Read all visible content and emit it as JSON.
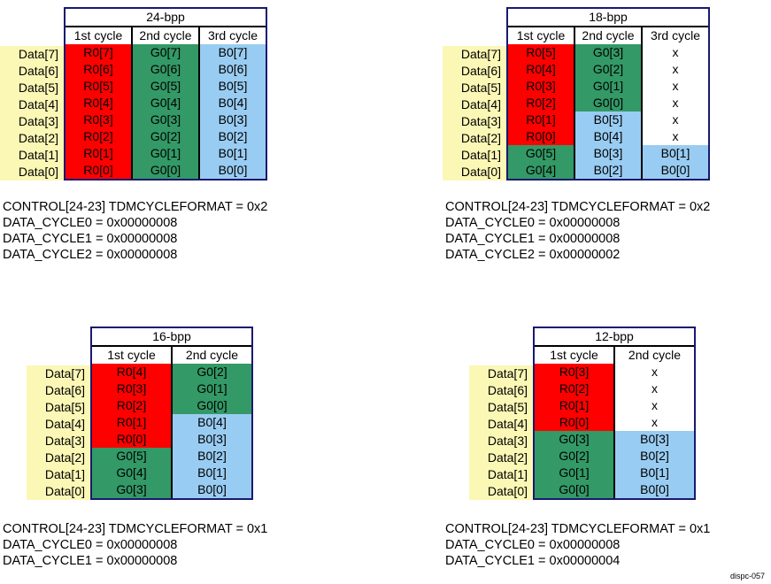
{
  "figure_id": "dispc-057",
  "colors": {
    "red": "#FF0000",
    "green": "#339966",
    "blue": "#99CCF2",
    "yellow": "#FBF7B5",
    "white": "#FFFFFF",
    "border_outer": "#191970",
    "border_inner": "#000000"
  },
  "row_labels": [
    "Data[7]",
    "Data[6]",
    "Data[5]",
    "Data[4]",
    "Data[3]",
    "Data[2]",
    "Data[1]",
    "Data[0]"
  ],
  "panels": [
    {
      "id": "24bpp",
      "title": "24-bpp",
      "cycle_headers": [
        "1st cycle",
        "2nd cycle",
        "3rd cycle"
      ],
      "columns": [
        {
          "header": "1st cycle",
          "cells": [
            {
              "text": "R0[7]",
              "color": "red"
            },
            {
              "text": "R0[6]",
              "color": "red"
            },
            {
              "text": "R0[5]",
              "color": "red"
            },
            {
              "text": "R0[4]",
              "color": "red"
            },
            {
              "text": "R0[3]",
              "color": "red"
            },
            {
              "text": "R0[2]",
              "color": "red"
            },
            {
              "text": "R0[1]",
              "color": "red"
            },
            {
              "text": "R0[0]",
              "color": "red"
            }
          ]
        },
        {
          "header": "2nd cycle",
          "cells": [
            {
              "text": "G0[7]",
              "color": "green"
            },
            {
              "text": "G0[6]",
              "color": "green"
            },
            {
              "text": "G0[5]",
              "color": "green"
            },
            {
              "text": "G0[4]",
              "color": "green"
            },
            {
              "text": "G0[3]",
              "color": "green"
            },
            {
              "text": "G0[2]",
              "color": "green"
            },
            {
              "text": "G0[1]",
              "color": "green"
            },
            {
              "text": "G0[0]",
              "color": "green"
            }
          ]
        },
        {
          "header": "3rd cycle",
          "cells": [
            {
              "text": "B0[7]",
              "color": "blue"
            },
            {
              "text": "B0[6]",
              "color": "blue"
            },
            {
              "text": "B0[5]",
              "color": "blue"
            },
            {
              "text": "B0[4]",
              "color": "blue"
            },
            {
              "text": "B0[3]",
              "color": "blue"
            },
            {
              "text": "B0[2]",
              "color": "blue"
            },
            {
              "text": "B0[1]",
              "color": "blue"
            },
            {
              "text": "B0[0]",
              "color": "blue"
            }
          ]
        }
      ],
      "caption": [
        "CONTROL[24-23] TDMCYCLEFORMAT = 0x2",
        "DATA_CYCLE0 = 0x00000008",
        "DATA_CYCLE1 = 0x00000008",
        "DATA_CYCLE2 = 0x00000008"
      ]
    },
    {
      "id": "18bpp",
      "title": "18-bpp",
      "cycle_headers": [
        "1st cycle",
        "2nd cycle",
        "3rd cycle"
      ],
      "columns": [
        {
          "header": "1st cycle",
          "cells": [
            {
              "text": "R0[5]",
              "color": "red"
            },
            {
              "text": "R0[4]",
              "color": "red"
            },
            {
              "text": "R0[3]",
              "color": "red"
            },
            {
              "text": "R0[2]",
              "color": "red"
            },
            {
              "text": "R0[1]",
              "color": "red"
            },
            {
              "text": "R0[0]",
              "color": "red"
            },
            {
              "text": "G0[5]",
              "color": "green"
            },
            {
              "text": "G0[4]",
              "color": "green"
            }
          ]
        },
        {
          "header": "2nd cycle",
          "cells": [
            {
              "text": "G0[3]",
              "color": "green"
            },
            {
              "text": "G0[2]",
              "color": "green"
            },
            {
              "text": "G0[1]",
              "color": "green"
            },
            {
              "text": "G0[0]",
              "color": "green"
            },
            {
              "text": "B0[5]",
              "color": "blue"
            },
            {
              "text": "B0[4]",
              "color": "blue"
            },
            {
              "text": "B0[3]",
              "color": "blue"
            },
            {
              "text": "B0[2]",
              "color": "blue"
            }
          ]
        },
        {
          "header": "3rd cycle",
          "cells": [
            {
              "text": "x",
              "color": "white"
            },
            {
              "text": "x",
              "color": "white"
            },
            {
              "text": "x",
              "color": "white"
            },
            {
              "text": "x",
              "color": "white"
            },
            {
              "text": "x",
              "color": "white"
            },
            {
              "text": "x",
              "color": "white"
            },
            {
              "text": "B0[1]",
              "color": "blue"
            },
            {
              "text": "B0[0]",
              "color": "blue"
            }
          ]
        }
      ],
      "caption": [
        "CONTROL[24-23] TDMCYCLEFORMAT = 0x2",
        "DATA_CYCLE0 = 0x00000008",
        "DATA_CYCLE1 = 0x00000008",
        "DATA_CYCLE2 = 0x00000002"
      ]
    },
    {
      "id": "16bpp",
      "title": "16-bpp",
      "cycle_headers": [
        "1st cycle",
        "2nd cycle"
      ],
      "columns": [
        {
          "header": "1st cycle",
          "cells": [
            {
              "text": "R0[4]",
              "color": "red"
            },
            {
              "text": "R0[3]",
              "color": "red"
            },
            {
              "text": "R0[2]",
              "color": "red"
            },
            {
              "text": "R0[1]",
              "color": "red"
            },
            {
              "text": "R0[0]",
              "color": "red"
            },
            {
              "text": "G0[5]",
              "color": "green"
            },
            {
              "text": "G0[4]",
              "color": "green"
            },
            {
              "text": "G0[3]",
              "color": "green"
            }
          ]
        },
        {
          "header": "2nd cycle",
          "cells": [
            {
              "text": "G0[2]",
              "color": "green"
            },
            {
              "text": "G0[1]",
              "color": "green"
            },
            {
              "text": "G0[0]",
              "color": "green"
            },
            {
              "text": "B0[4]",
              "color": "blue"
            },
            {
              "text": "B0[3]",
              "color": "blue"
            },
            {
              "text": "B0[2]",
              "color": "blue"
            },
            {
              "text": "B0[1]",
              "color": "blue"
            },
            {
              "text": "B0[0]",
              "color": "blue"
            }
          ]
        }
      ],
      "caption": [
        "CONTROL[24-23] TDMCYCLEFORMAT = 0x1",
        "DATA_CYCLE0 = 0x00000008",
        "DATA_CYCLE1 = 0x00000008"
      ]
    },
    {
      "id": "12bpp",
      "title": "12-bpp",
      "cycle_headers": [
        "1st cycle",
        "2nd cycle"
      ],
      "columns": [
        {
          "header": "1st cycle",
          "cells": [
            {
              "text": "R0[3]",
              "color": "red"
            },
            {
              "text": "R0[2]",
              "color": "red"
            },
            {
              "text": "R0[1]",
              "color": "red"
            },
            {
              "text": "R0[0]",
              "color": "red"
            },
            {
              "text": "G0[3]",
              "color": "green"
            },
            {
              "text": "G0[2]",
              "color": "green"
            },
            {
              "text": "G0[1]",
              "color": "green"
            },
            {
              "text": "G0[0]",
              "color": "green"
            }
          ]
        },
        {
          "header": "2nd cycle",
          "cells": [
            {
              "text": "x",
              "color": "white"
            },
            {
              "text": "x",
              "color": "white"
            },
            {
              "text": "x",
              "color": "white"
            },
            {
              "text": "x",
              "color": "white"
            },
            {
              "text": "B0[3]",
              "color": "blue"
            },
            {
              "text": "B0[2]",
              "color": "blue"
            },
            {
              "text": "B0[1]",
              "color": "blue"
            },
            {
              "text": "B0[0]",
              "color": "blue"
            }
          ]
        }
      ],
      "caption": [
        "CONTROL[24-23] TDMCYCLEFORMAT = 0x1",
        "DATA_CYCLE0 = 0x00000008",
        "DATA_CYCLE1 = 0x00000004"
      ]
    }
  ]
}
